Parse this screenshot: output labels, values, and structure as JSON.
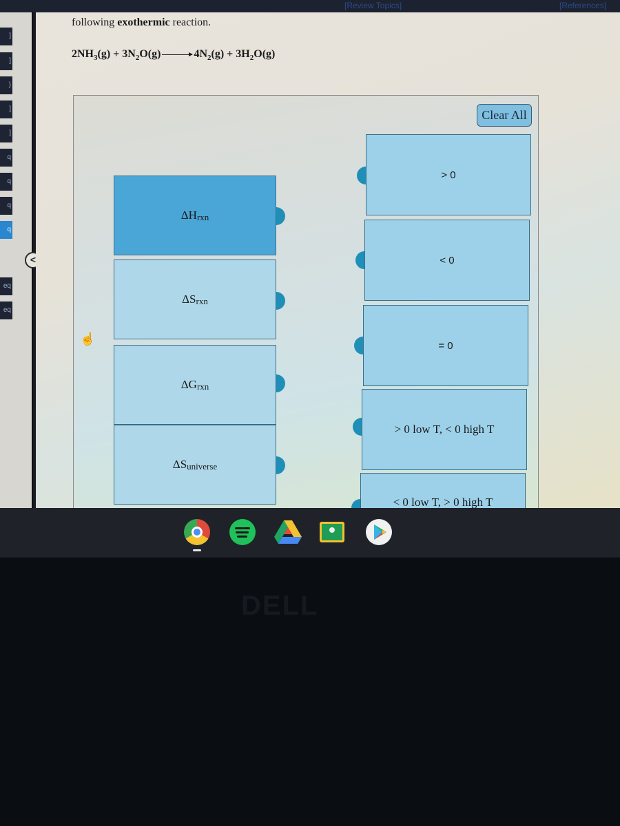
{
  "topbar": {
    "review_topics": "[Review Topics]",
    "references": "[References]"
  },
  "sidebar": {
    "items": [
      "]",
      "]",
      ")",
      "]",
      "]",
      "q",
      "q",
      "q",
      "q",
      "eq",
      "eq"
    ],
    "active_index": 8,
    "collapse_label": "<"
  },
  "question": {
    "text_prefix": "following ",
    "text_emphasis": "exothermic",
    "text_suffix": " reaction.",
    "equation": {
      "reactants": [
        {
          "coef": "2",
          "formula": "NH",
          "sub": "3",
          "state": "(g)"
        },
        {
          "coef": "3",
          "formula": "N",
          "sub": "2",
          "formula2": "O",
          "state": "(g)"
        }
      ],
      "products": [
        {
          "coef": "4",
          "formula": "N",
          "sub": "2",
          "state": "(g)"
        },
        {
          "coef": "3",
          "formula": "H",
          "sub": "2",
          "formula2": "O",
          "state": "(g)"
        }
      ],
      "plus": "+"
    }
  },
  "matching": {
    "clear_all_label": "Clear All",
    "left_items": [
      {
        "prefix": "ΔH",
        "sub": "rxn",
        "selected": true
      },
      {
        "prefix": "ΔS",
        "sub": "rxn",
        "selected": false
      },
      {
        "prefix": "ΔG",
        "sub": "rxn",
        "selected": false
      },
      {
        "prefix": "ΔS",
        "sub": "universe",
        "selected": false
      }
    ],
    "right_items": [
      {
        "label": "> 0"
      },
      {
        "label": "< 0"
      },
      {
        "label": "= 0"
      },
      {
        "label": "> 0 low T, < 0 high T"
      },
      {
        "label": "< 0 low T, > 0 high T"
      }
    ]
  },
  "shelf": {
    "apps": [
      "chrome",
      "spotify",
      "google-drive",
      "google-classroom",
      "play-store"
    ],
    "active_app": "chrome"
  },
  "bezel": {
    "brand": "DELL"
  },
  "colors": {
    "selected_card": "#4aa6d6",
    "card": "#aed8ea",
    "connector": "#1f8fb8",
    "button": "#7fbfe0"
  }
}
